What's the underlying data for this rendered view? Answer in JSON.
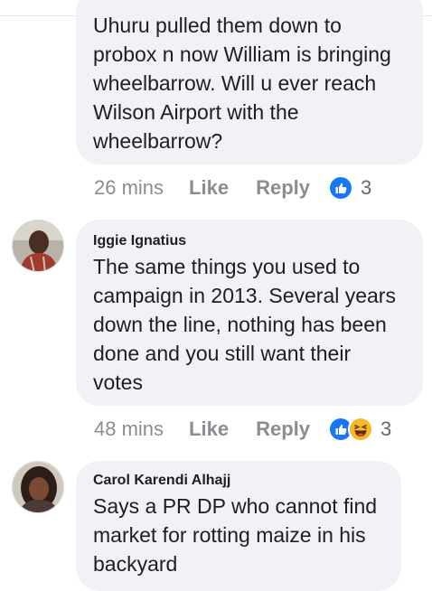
{
  "comments": [
    {
      "text": "Uhuru pulled them down to\nprobox n now William is bringing\nwheelbarrow. Will u ever reach\nWilson Airport with the\nwheelbarrow?",
      "time": "26 mins",
      "like_label": "Like",
      "reply_label": "Reply",
      "reaction_icons": [
        "like-reaction-icon"
      ],
      "reaction_count": "3"
    },
    {
      "author": "Iggie Ignatius",
      "text": "The same things you used to\ncampaign in 2013. Several years\ndown the line, nothing has been\ndone and you still want their\nvotes",
      "time": "48 mins",
      "like_label": "Like",
      "reply_label": "Reply",
      "reaction_icons": [
        "like-reaction-icon",
        "haha-reaction-icon"
      ],
      "reaction_count": "3"
    },
    {
      "author": "Carol Karendi Alhajj",
      "text": "Says a PR DP who cannot find\nmarket for rotting maize in his\nbackyard"
    }
  ],
  "colors": {
    "bubble_bg": "#f0f2f5",
    "meta_text": "#8a8d91",
    "like_blue": "#1877f2",
    "haha_yellow": "#f7b928"
  }
}
